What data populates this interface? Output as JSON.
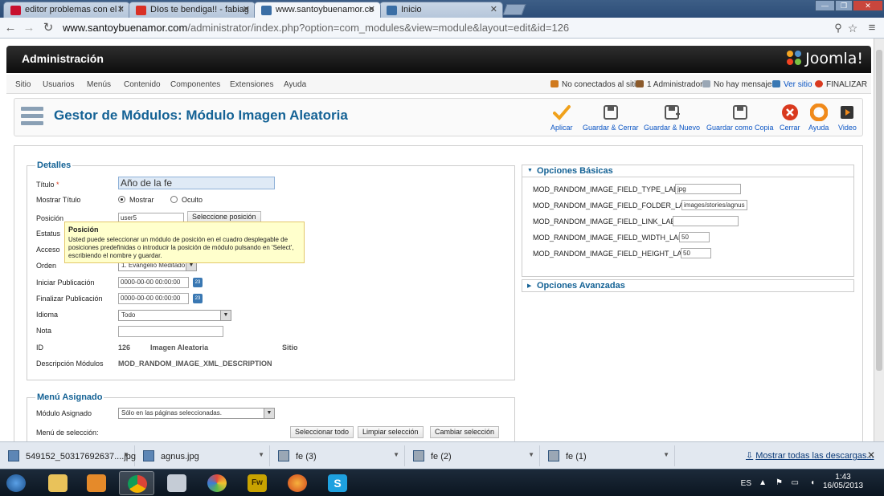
{
  "browser": {
    "tabs": [
      {
        "title": "editor problemas con el h",
        "active": false,
        "favicon_color": "#c8102e"
      },
      {
        "title": "DIos te bendiga!! - fabiag",
        "active": false,
        "favicon_color": "#d93025"
      },
      {
        "title": "www.santoybuenamor.co",
        "active": true,
        "favicon_color": "#3a6ea5"
      },
      {
        "title": "Inicio",
        "active": false,
        "favicon_color": "#3a6ea5"
      }
    ],
    "url_host": "www.santoybuenamor.com",
    "url_path": "/administrator/index.php?option=com_modules&view=module&layout=edit&id=126"
  },
  "joomla": {
    "admin_title": "Administración",
    "logo_text": "Joomla!",
    "menu": [
      "Sitio",
      "Usuarios",
      "Menús",
      "Contenido",
      "Componentes",
      "Extensiones",
      "Ayuda"
    ],
    "status": {
      "not_connected": "No conectados al sitio",
      "admins": "1 Administrador",
      "messages": "No hay mensajes",
      "view_site": "Ver sitio",
      "logout": "FINALIZAR"
    },
    "page_title": "Gestor de Módulos: Módulo Imagen Aleatoria",
    "toolbar": {
      "apply": "Aplicar",
      "save_close": "Guardar & Cerrar",
      "save_new": "Guardar & Nuevo",
      "save_copy": "Guardar como Copia",
      "close": "Cerrar",
      "help": "Ayuda",
      "video": "Video"
    },
    "details": {
      "legend": "Detalles",
      "title_label": "Título",
      "title_required": "*",
      "title_value": "Año de la fe",
      "show_title_label": "Mostrar Título",
      "show_option": "Mostrar",
      "hide_option": "Oculto",
      "position_label": "Posición",
      "position_value": "user5",
      "select_position_button": "Seleccione posición",
      "status_label": "Estatus",
      "access_label": "Acceso",
      "order_label": "Orden",
      "order_value": "1. Evangelio Meditado",
      "start_label": "Iniciar Publicación",
      "start_value": "0000-00-00 00:00:00",
      "finish_label": "Finalizar Publicación",
      "finish_value": "0000-00-00 00:00:00",
      "language_label": "Idioma",
      "language_value": "Todo",
      "note_label": "Nota",
      "note_value": "",
      "id_label": "ID",
      "id_value": "126",
      "module_name": "Imagen Aleatoria",
      "module_site": "Sitio",
      "description_label": "Descripción Módulos",
      "description_value": "MOD_RANDOM_IMAGE_XML_DESCRIPTION"
    },
    "tooltip": {
      "title": "Posición",
      "body": "Usted puede seleccionar un módulo de posición en el cuadro desplegable de posiciones predefinidas o introducir la posición de módulo pulsando en 'Select', escribiendo el nombre y guardar."
    },
    "menu_assignment": {
      "legend": "Menú Asignado",
      "assigned_label": "Módulo Asignado",
      "assigned_value": "Sólo en las páginas seleccionadas.",
      "selection_label": "Menú de selección:",
      "select_all": "Seleccionar todo",
      "clear_selection": "Limpiar selección",
      "toggle_selection": "Cambiar selección"
    },
    "basic_options": {
      "header": "Opciones Básicas",
      "fields": [
        {
          "label": "MOD_RANDOM_IMAGE_FIELD_TYPE_LABEL",
          "value": "jpg"
        },
        {
          "label": "MOD_RANDOM_IMAGE_FIELD_FOLDER_LABEL",
          "value": "images/stories/agnus"
        },
        {
          "label": "MOD_RANDOM_IMAGE_FIELD_LINK_LABEL",
          "value": ""
        },
        {
          "label": "MOD_RANDOM_IMAGE_FIELD_WIDTH_LABEL",
          "value": "50"
        },
        {
          "label": "MOD_RANDOM_IMAGE_FIELD_HEIGHT_LABEL",
          "value": "50"
        }
      ]
    },
    "advanced_options": {
      "header": "Opciones Avanzadas"
    }
  },
  "downloads": {
    "items": [
      "549152_50317692637....jpg",
      "agnus.jpg",
      "fe (3)",
      "fe (2)",
      "fe (1)"
    ],
    "show_all": "Mostrar todas las descargas..."
  },
  "taskbar": {
    "language": "ES",
    "time": "1:43",
    "date": "16/05/2013"
  },
  "colors": {
    "joomla_blue": "#146295",
    "link_blue": "#0b55c4",
    "close_red": "#d9391e",
    "apply_orange": "#f0a11b"
  }
}
